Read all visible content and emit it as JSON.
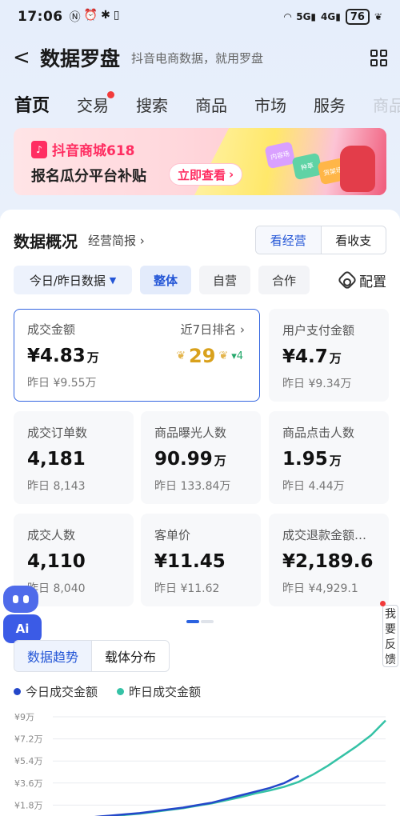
{
  "status_bar": {
    "time": "17:06",
    "battery": "76"
  },
  "header": {
    "title": "数据罗盘",
    "subtitle": "抖音电商数据，就用罗盘"
  },
  "tabs": [
    {
      "label": "首页",
      "active": true
    },
    {
      "label": "交易",
      "badge": true
    },
    {
      "label": "搜索"
    },
    {
      "label": "商品"
    },
    {
      "label": "市场"
    },
    {
      "label": "服务"
    },
    {
      "label": "商品"
    }
  ],
  "banner": {
    "brand": "抖音商城618",
    "slogan": "报名瓜分平台补贴",
    "cta": "立即查看",
    "stickers": [
      "内容场",
      "种草",
      "货架场"
    ]
  },
  "overview": {
    "title": "数据概况",
    "report_link": "经营简报",
    "toggle": [
      "看经营",
      "看收支"
    ],
    "date_filter": "今日/昨日数据",
    "chips": [
      "整体",
      "自营",
      "合作"
    ],
    "config_label": "配置"
  },
  "metrics": [
    {
      "label": "成交金额",
      "value": "¥4.83",
      "unit": "万",
      "prev": "昨日 ¥9.55万",
      "rank_label": "近7日排名",
      "rank": "29",
      "rank_change": "4"
    },
    {
      "label": "用户支付金额",
      "value": "¥4.7",
      "unit": "万",
      "prev": "昨日 ¥9.34万"
    },
    {
      "label": "成交订单数",
      "value": "4,181",
      "unit": "",
      "prev": "昨日 8,143"
    },
    {
      "label": "商品曝光人数",
      "value": "90.99",
      "unit": "万",
      "prev": "昨日 133.84万"
    },
    {
      "label": "商品点击人数",
      "value": "1.95",
      "unit": "万",
      "prev": "昨日 4.44万"
    },
    {
      "label": "成交人数",
      "value": "4,110",
      "unit": "",
      "prev": "昨日 8,040"
    },
    {
      "label": "客单价",
      "value": "¥11.45",
      "unit": "",
      "prev": "昨日 ¥11.62"
    },
    {
      "label": "成交退款金额…",
      "value": "¥2,189.6",
      "unit": "",
      "prev": "昨日 ¥4,929.1"
    }
  ],
  "ai_label": "Ai",
  "feedback": [
    "我",
    "要",
    "反",
    "馈"
  ],
  "trend_tabs": [
    "数据趋势",
    "载体分布"
  ],
  "colors": {
    "accent": "#2456d6",
    "today_line": "#2447c9",
    "yesterday_line": "#35c2a6"
  },
  "chart_data": {
    "type": "line",
    "y_ticks": [
      "¥9万",
      "¥7.2万",
      "¥5.4万",
      "¥3.6万",
      "¥1.8万"
    ],
    "ylim": [
      0,
      9
    ],
    "series": [
      {
        "name": "今日成交金额",
        "x": [
          0,
          1,
          2,
          3,
          4,
          5,
          6,
          7,
          8,
          9,
          10,
          11,
          12,
          13,
          14,
          15,
          16,
          17
        ],
        "values": [
          0.0,
          0.4,
          0.7,
          0.85,
          0.95,
          1.05,
          1.15,
          1.3,
          1.45,
          1.6,
          1.8,
          2.0,
          2.3,
          2.6,
          2.9,
          3.2,
          3.6,
          4.2
        ]
      },
      {
        "name": "昨日成交金额",
        "x": [
          0,
          1,
          2,
          3,
          4,
          5,
          6,
          7,
          8,
          9,
          10,
          11,
          12,
          13,
          14,
          15,
          16,
          17,
          18,
          19,
          20,
          21,
          22,
          23
        ],
        "values": [
          0.0,
          0.35,
          0.6,
          0.8,
          0.9,
          1.0,
          1.1,
          1.25,
          1.4,
          1.55,
          1.75,
          1.95,
          2.2,
          2.45,
          2.75,
          3.0,
          3.3,
          3.7,
          4.3,
          5.0,
          5.8,
          6.6,
          7.5,
          8.7
        ]
      }
    ]
  }
}
